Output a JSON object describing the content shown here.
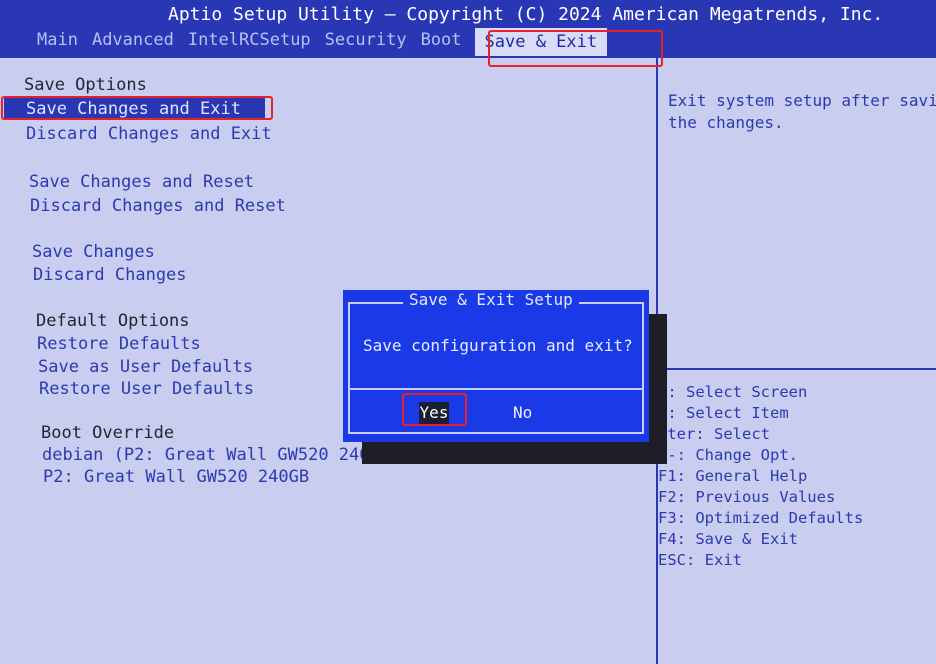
{
  "header": {
    "title": "Aptio Setup Utility – Copyright (C) 2024 American Megatrends, Inc.",
    "tabs": [
      "Main",
      "Advanced",
      "IntelRCSetup",
      "Security",
      "Boot",
      "Save & Exit"
    ],
    "active_tab": "Save & Exit"
  },
  "menu": {
    "save_options_header": "Save Options",
    "save_changes_and_exit": "Save Changes and Exit",
    "discard_changes_and_exit": "Discard Changes and Exit",
    "save_changes_and_reset": "Save Changes and Reset",
    "discard_changes_and_reset": "Discard Changes and Reset",
    "save_changes": "Save Changes",
    "discard_changes": "Discard Changes",
    "default_options_header": "Default Options",
    "restore_defaults": "Restore Defaults",
    "save_as_user_defaults": "Save as User Defaults",
    "restore_user_defaults": "Restore User Defaults",
    "boot_override_header": "Boot Override",
    "boot_override_1": "debian (P2: Great Wall GW520 240G",
    "boot_override_2": "P2: Great Wall GW520 240GB"
  },
  "help": {
    "description": "Exit system setup after savi\nthe changes.",
    "keys": "+: Select Screen\n↓: Select Item\nnter: Select\n/-: Change Opt.\nF1: General Help\nF2: Previous Values\nF3: Optimized Defaults\nF4: Save & Exit\nESC: Exit"
  },
  "dialog": {
    "title": "Save & Exit Setup",
    "message": "Save configuration and exit?",
    "yes_label": "Yes",
    "no_label": "No"
  },
  "colors": {
    "screen_blue": "#2a37b5",
    "panel_bg": "#c9cdef",
    "dialog_blue": "#1a3ae8",
    "annotation_red": "#e8202a"
  }
}
